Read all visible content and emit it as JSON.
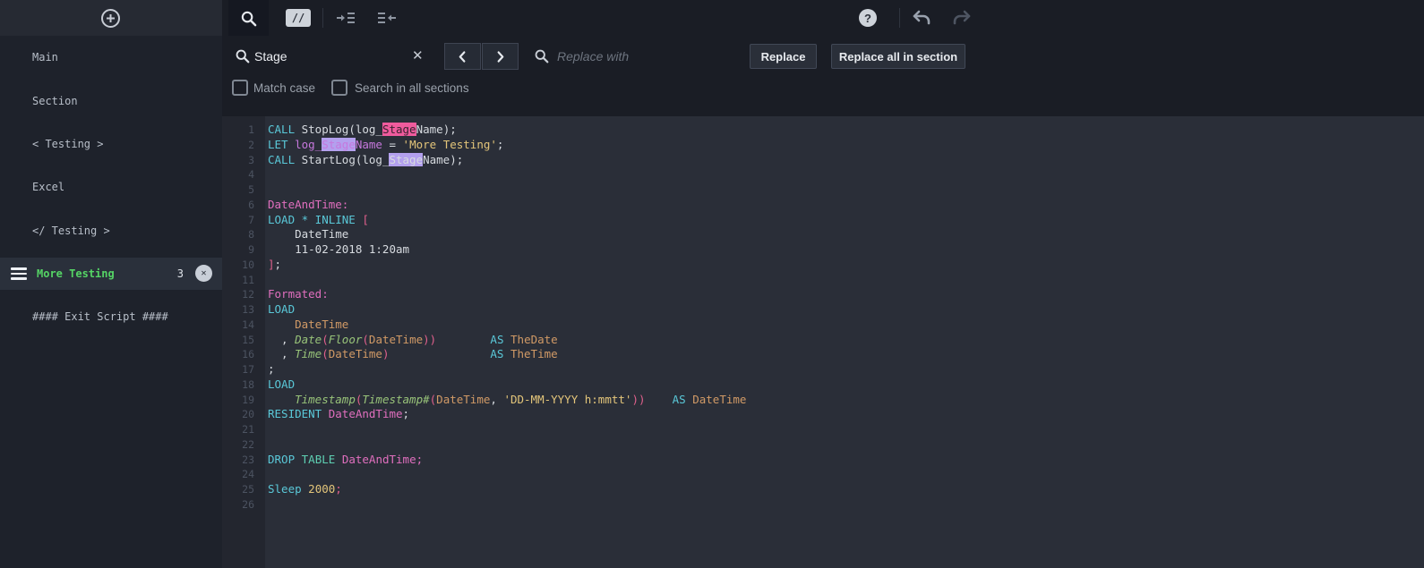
{
  "colors": {
    "match_current": "#ef5b9d",
    "match_other": "#b3a0ee",
    "active_section_green": "#55d465"
  },
  "topbar": {
    "comment_glyph": "//",
    "help_glyph": "?"
  },
  "search": {
    "query": "Stage",
    "clear_glyph": "✕",
    "replace_placeholder": "Replace with",
    "replace_label": "Replace",
    "replace_all_label": "Replace all in section",
    "match_case": {
      "label": "Match case",
      "checked": false
    },
    "all_sections": {
      "label": "Search in all sections",
      "checked": false
    }
  },
  "sidebar": {
    "items": [
      {
        "label": "Main"
      },
      {
        "label": "Section"
      },
      {
        "label": "< Testing >"
      },
      {
        "label": "Excel"
      },
      {
        "label": "</ Testing >"
      },
      {
        "label": "More Testing",
        "active": true,
        "count": "3",
        "close_glyph": "✕"
      },
      {
        "label": "#### Exit Script ####"
      }
    ]
  },
  "editor": {
    "line_count": 26,
    "lines": [
      [
        [
          "kw",
          "CALL"
        ],
        [
          "pln",
          " StopLog(log_"
        ],
        [
          "pln",
          "Stage",
          "cur"
        ],
        [
          "pln",
          "Name);"
        ]
      ],
      [
        [
          "kw",
          "LET"
        ],
        [
          "pln",
          " "
        ],
        [
          "var",
          "log_"
        ],
        [
          "var",
          "Stage",
          "alt"
        ],
        [
          "var",
          "Name"
        ],
        [
          "pln",
          " = "
        ],
        [
          "str",
          "'More Testing'"
        ],
        [
          "pln",
          ";"
        ]
      ],
      [
        [
          "kw",
          "CALL"
        ],
        [
          "pln",
          " StartLog(log_"
        ],
        [
          "pln",
          "Stage",
          "alt"
        ],
        [
          "pln",
          "Name);"
        ]
      ],
      [],
      [],
      [
        [
          "tbl",
          "DateAndTime:"
        ]
      ],
      [
        [
          "kw",
          "LOAD * INLINE"
        ],
        [
          "pln",
          " "
        ],
        [
          "brk",
          "["
        ]
      ],
      [
        [
          "pln",
          "    DateTime"
        ]
      ],
      [
        [
          "pln",
          "    11-02-2018 1:20am"
        ]
      ],
      [
        [
          "brk",
          "]"
        ],
        [
          "pln",
          ";"
        ]
      ],
      [],
      [
        [
          "tbl",
          "Formated:"
        ]
      ],
      [
        [
          "kw",
          "LOAD"
        ]
      ],
      [
        [
          "pln",
          "    "
        ],
        [
          "fld",
          "DateTime"
        ]
      ],
      [
        [
          "pln",
          "  , "
        ],
        [
          "fn",
          "Date"
        ],
        [
          "brk",
          "("
        ],
        [
          "fn",
          "Floor"
        ],
        [
          "brk",
          "("
        ],
        [
          "fld",
          "DateTime"
        ],
        [
          "brk",
          "))"
        ],
        [
          "pln",
          "        "
        ],
        [
          "kw",
          "AS"
        ],
        [
          "pln",
          " "
        ],
        [
          "fld",
          "TheDate"
        ]
      ],
      [
        [
          "pln",
          "  , "
        ],
        [
          "fn",
          "Time"
        ],
        [
          "brk",
          "("
        ],
        [
          "fld",
          "DateTime"
        ],
        [
          "brk",
          ")"
        ],
        [
          "pln",
          "               "
        ],
        [
          "kw",
          "AS"
        ],
        [
          "pln",
          " "
        ],
        [
          "fld",
          "TheTime"
        ]
      ],
      [
        [
          "pln",
          ";"
        ]
      ],
      [
        [
          "kw",
          "LOAD"
        ]
      ],
      [
        [
          "pln",
          "    "
        ],
        [
          "fn",
          "Timestamp"
        ],
        [
          "brk",
          "("
        ],
        [
          "fn",
          "Timestamp#"
        ],
        [
          "brk",
          "("
        ],
        [
          "fld",
          "DateTime"
        ],
        [
          "pln",
          ", "
        ],
        [
          "str",
          "'DD-MM-YYYY h:mmtt'"
        ],
        [
          "brk",
          "))"
        ],
        [
          "pln",
          "    "
        ],
        [
          "kw",
          "AS"
        ],
        [
          "pln",
          " "
        ],
        [
          "fld",
          "DateTime"
        ]
      ],
      [
        [
          "kw",
          "RESIDENT"
        ],
        [
          "pln",
          " "
        ],
        [
          "tbl",
          "DateAndTime"
        ],
        [
          "pln",
          ";"
        ]
      ],
      [],
      [],
      [
        [
          "kw",
          "DROP "
        ],
        [
          "kw2",
          "TABLE"
        ],
        [
          "pln",
          " "
        ],
        [
          "tbl",
          "DateAndTime;"
        ]
      ],
      [],
      [
        [
          "kw",
          "Sleep"
        ],
        [
          "pln",
          " "
        ],
        [
          "num",
          "2000"
        ],
        [
          "brk",
          ";"
        ]
      ],
      []
    ]
  }
}
